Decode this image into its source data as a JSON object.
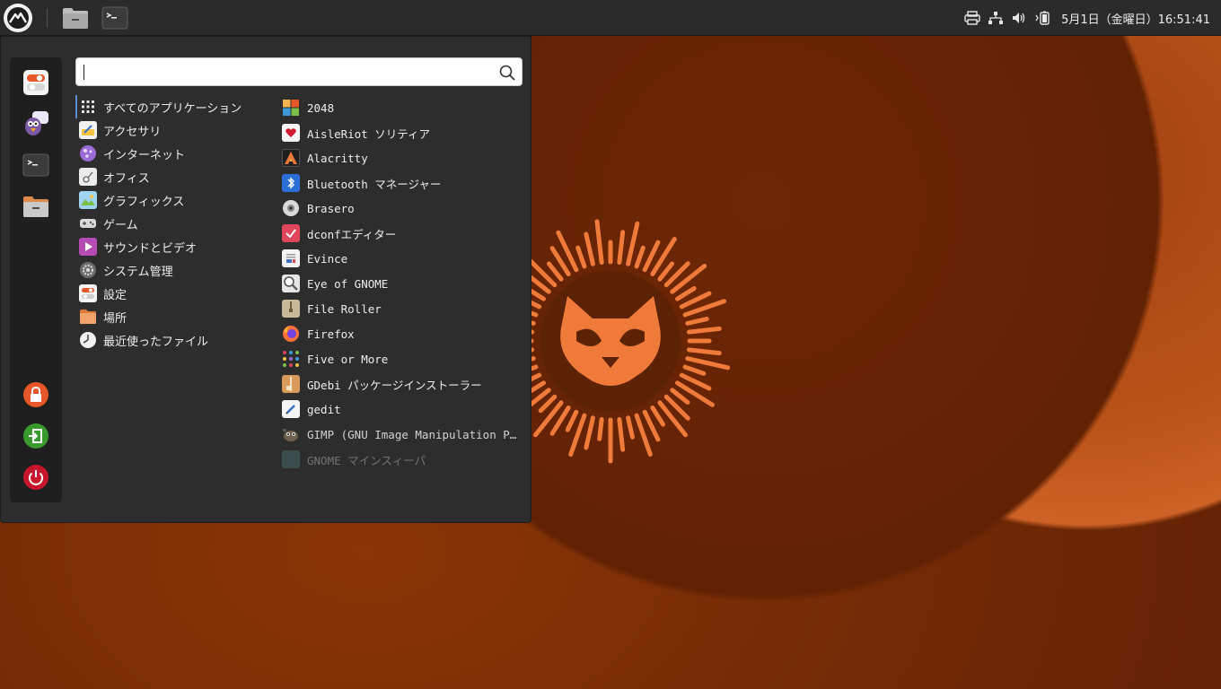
{
  "panel": {
    "clock": "5月1日（金曜日）16:51:41",
    "launchers": [
      "file-manager-icon",
      "terminal-icon"
    ],
    "tray_icons": [
      "printer-icon",
      "network-icon",
      "volume-icon",
      "battery-icon"
    ]
  },
  "menu": {
    "search": {
      "value": "",
      "placeholder": ""
    },
    "sidebar": [
      "settings-manager",
      "pidgin",
      "terminal",
      "file-manager",
      "lock-screen",
      "log-out",
      "shutdown"
    ],
    "categories": [
      {
        "label": "すべてのアプリケーション",
        "icon": "grid-icon"
      },
      {
        "label": "アクセサリ",
        "icon": "accessories-icon"
      },
      {
        "label": "インターネット",
        "icon": "internet-icon"
      },
      {
        "label": "オフィス",
        "icon": "office-icon"
      },
      {
        "label": "グラフィックス",
        "icon": "graphics-icon"
      },
      {
        "label": "ゲーム",
        "icon": "games-icon"
      },
      {
        "label": "サウンドとビデオ",
        "icon": "multimedia-icon"
      },
      {
        "label": "システム管理",
        "icon": "system-icon"
      },
      {
        "label": "設定",
        "icon": "settings-icon"
      },
      {
        "label": "場所",
        "icon": "places-icon"
      },
      {
        "label": "最近使ったファイル",
        "icon": "recent-files-icon"
      }
    ],
    "apps": [
      {
        "label": "2048",
        "icon": "2048-icon"
      },
      {
        "label": "AisleRiot ソリティア",
        "icon": "aisleriot-icon"
      },
      {
        "label": "Alacritty",
        "icon": "alacritty-icon"
      },
      {
        "label": "Bluetooth マネージャー",
        "icon": "bluetooth-icon"
      },
      {
        "label": "Brasero",
        "icon": "brasero-icon"
      },
      {
        "label": "dconfエディター",
        "icon": "dconf-icon"
      },
      {
        "label": "Evince",
        "icon": "evince-icon"
      },
      {
        "label": "Eye of GNOME",
        "icon": "eog-icon"
      },
      {
        "label": "File Roller",
        "icon": "file-roller-icon"
      },
      {
        "label": "Firefox",
        "icon": "firefox-icon"
      },
      {
        "label": "Five or More",
        "icon": "five-or-more-icon"
      },
      {
        "label": "GDebi パッケージインストーラー",
        "icon": "gdebi-icon"
      },
      {
        "label": "gedit",
        "icon": "gedit-icon"
      },
      {
        "label": "GIMP (GNU Image Manipulation P…",
        "icon": "gimp-icon"
      },
      {
        "label": "GNOME マインスィーパ",
        "icon": "mines-icon"
      }
    ]
  },
  "colors": {
    "panel_bg": "#2b2b2b",
    "menu_bg": "#2d2d2d",
    "wallpaper_orange": "#c5591c",
    "accent_blue": "#5a8fd1"
  }
}
